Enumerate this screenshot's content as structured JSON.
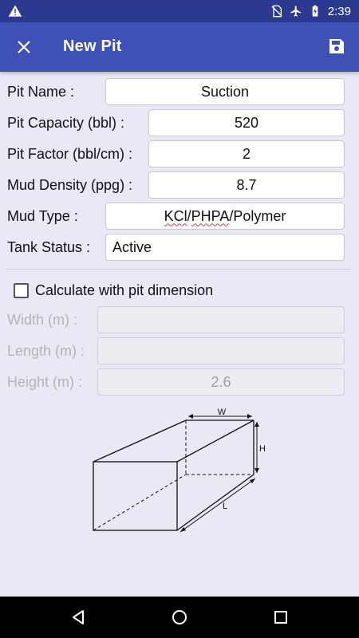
{
  "status_bar": {
    "time": "2:39",
    "icons": [
      "warning-icon",
      "no-sim-icon",
      "airplane-icon",
      "battery-icon"
    ]
  },
  "app_bar": {
    "title": "New Pit",
    "close_icon": "close-icon",
    "save_icon": "save-icon",
    "background": "#3f51b5"
  },
  "form": {
    "pit_name": {
      "label": "Pit Name :",
      "value": "Suction"
    },
    "pit_capacity": {
      "label": "Pit Capacity (bbl) :",
      "value": "520"
    },
    "pit_factor": {
      "label": "Pit Factor (bbl/cm) :",
      "value": "2"
    },
    "mud_density": {
      "label": "Mud Density (ppg) :",
      "value": "8.7"
    },
    "mud_type": {
      "label": "Mud Type :",
      "value_part1": "KCl",
      "sep1": "/",
      "value_part2": "PHPA",
      "sep2": "/",
      "value_part3": "Polymer"
    },
    "tank_status": {
      "label": "Tank Status :",
      "value": "Active"
    }
  },
  "dimension": {
    "checkbox_label": "Calculate with pit dimension",
    "checked": false,
    "width": {
      "label": "Width (m) :",
      "value": ""
    },
    "length": {
      "label": "Length (m) :",
      "value": ""
    },
    "height": {
      "label": "Height (m) :",
      "value": "2.6"
    }
  },
  "diagram_labels": {
    "w": "W",
    "h": "H",
    "l": "L"
  },
  "nav_bar": {
    "back_icon": "back-icon",
    "home_icon": "home-icon",
    "recents_icon": "recents-icon"
  }
}
